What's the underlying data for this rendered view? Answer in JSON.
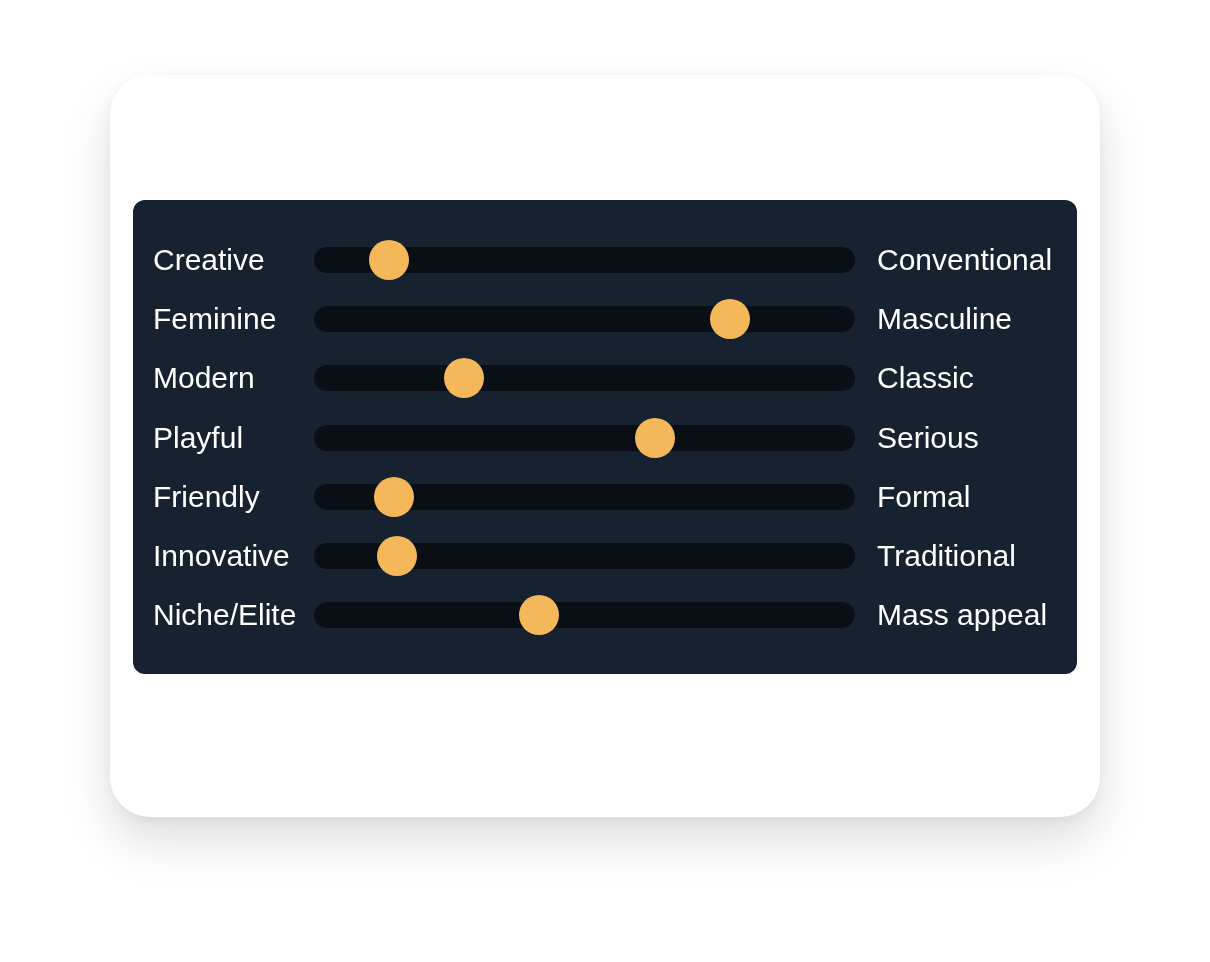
{
  "sliders": [
    {
      "left_label": "Creative",
      "right_label": "Conventional",
      "level": 0.11
    },
    {
      "left_label": "Feminine",
      "right_label": "Masculine",
      "level": 0.79
    },
    {
      "left_label": "Modern",
      "right_label": "Classic",
      "level": 0.26
    },
    {
      "left_label": "Playful",
      "right_label": "Serious",
      "level": 0.64
    },
    {
      "left_label": "Friendly",
      "right_label": "Formal",
      "level": 0.12
    },
    {
      "left_label": "Innovative",
      "right_label": "Traditional",
      "level": 0.125
    },
    {
      "left_label": "Niche/Elite",
      "right_label": "Mass appeal",
      "level": 0.41
    }
  ]
}
